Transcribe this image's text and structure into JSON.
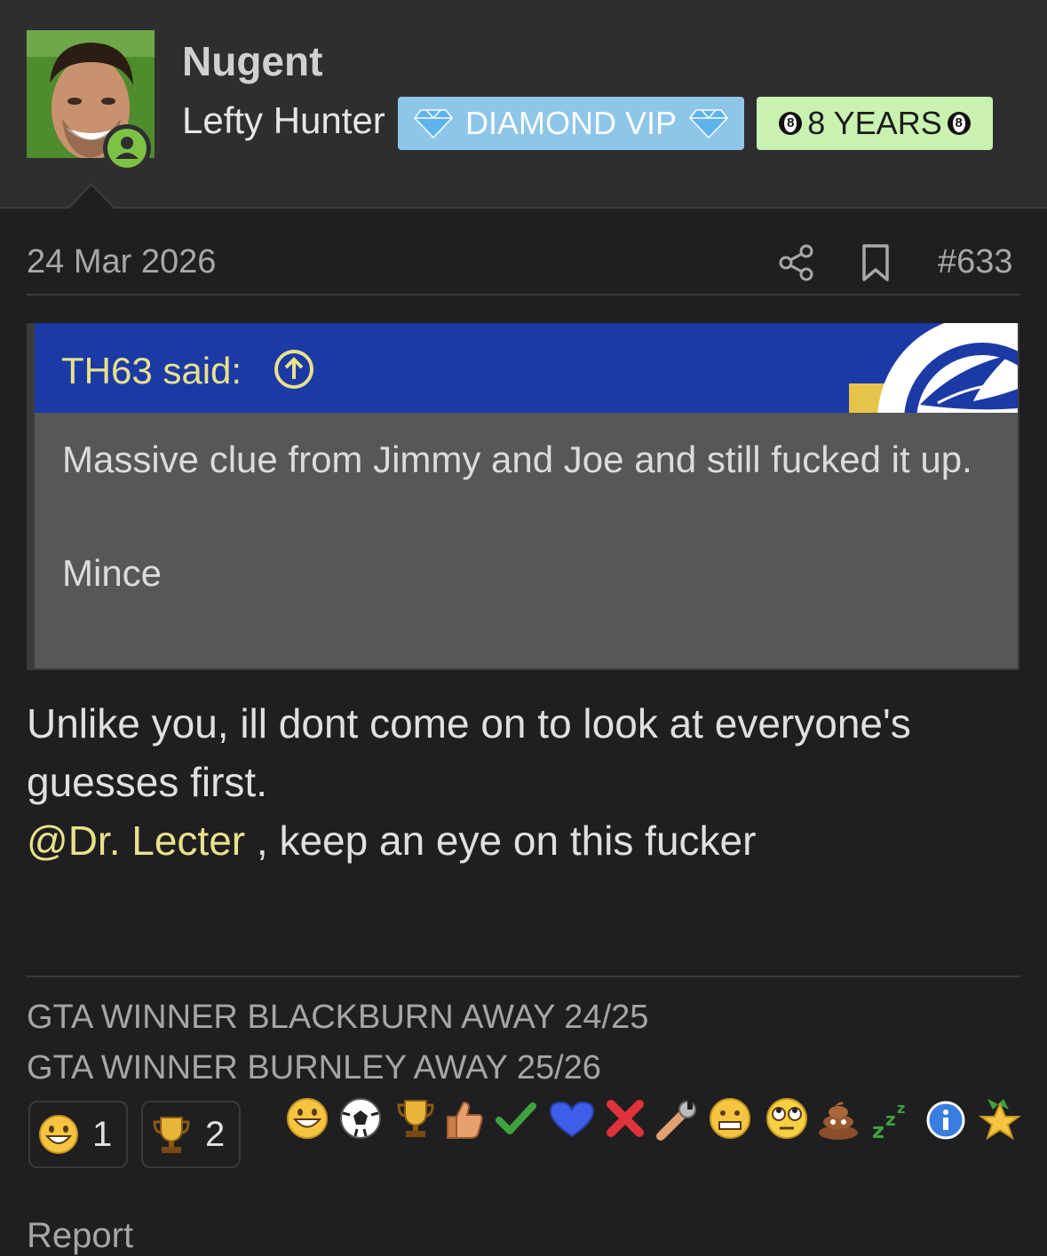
{
  "user": {
    "name": "Nugent",
    "title": "Lefty Hunter",
    "badge_vip": "DIAMOND VIP",
    "badge_years": "8 YEARS"
  },
  "post": {
    "date": "24 Mar 2026",
    "number": "#633"
  },
  "quote": {
    "author": "TH63 said:",
    "line1": "Massive clue from Jimmy and Joe and still fucked it up.",
    "line2": "Mince"
  },
  "message": {
    "line1": "Unlike you, ill dont come on to look at everyone's guesses first.",
    "mention": "@Dr. Lecter",
    "line2_rest": " , keep an eye on this fucker"
  },
  "signature": {
    "line1": "GTA WINNER BLACKBURN AWAY 24/25",
    "line2": "GTA WINNER BURNLEY AWAY 25/26"
  },
  "reactions": {
    "summary": [
      {
        "icon": "grin-icon",
        "count": "1"
      },
      {
        "icon": "trophy-icon",
        "count": "2"
      }
    ],
    "available": [
      "grin-icon",
      "football-icon",
      "trophy-icon",
      "thumbs-up-icon",
      "check-icon",
      "heart-icon",
      "cross-icon",
      "wrench-icon",
      "grimace-icon",
      "rolling-eyes-icon",
      "poo-icon",
      "sleep-icon",
      "info-icon",
      "star-medal-icon"
    ]
  },
  "footer": {
    "partial_text": "Report"
  },
  "colors": {
    "accent_yellow": "#e9e28a",
    "quote_header": "#1c3aa6",
    "vip_badge": "#8dc6e8",
    "years_badge": "#c9f2b0",
    "online": "#7dc244"
  }
}
